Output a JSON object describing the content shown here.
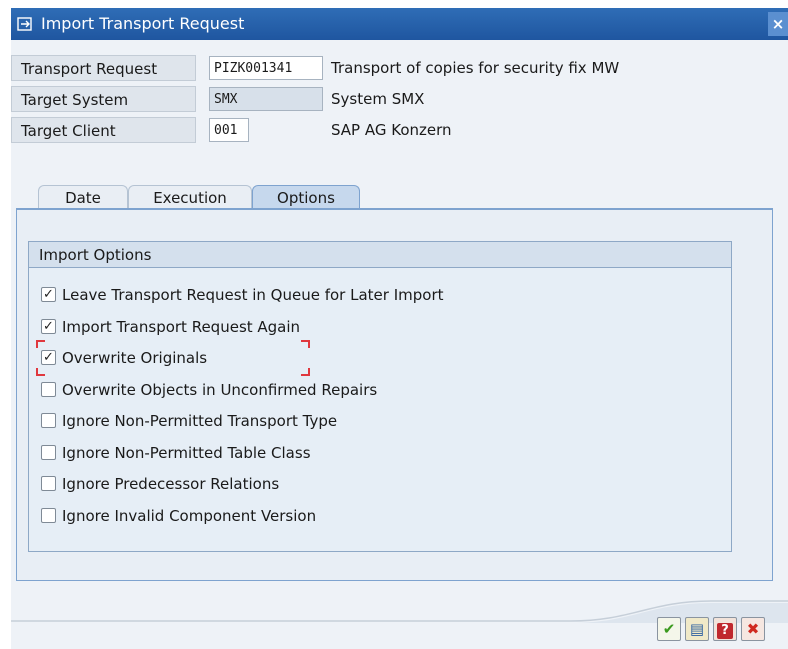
{
  "window": {
    "title": "Import Transport Request",
    "close_glyph": "×"
  },
  "header": {
    "transport_request": {
      "label": "Transport Request",
      "value": "PIZK001341",
      "description": "Transport of copies for security fix MW"
    },
    "target_system": {
      "label": "Target System",
      "value": "SMX",
      "description": "System SMX"
    },
    "target_client": {
      "label": "Target Client",
      "value": "001",
      "description": "SAP AG Konzern"
    }
  },
  "tabs": [
    {
      "label": "Date",
      "active": false
    },
    {
      "label": "Execution",
      "active": false
    },
    {
      "label": "Options",
      "active": true
    }
  ],
  "import_options": {
    "title": "Import Options",
    "items": [
      {
        "label": "Leave Transport Request in Queue for Later Import",
        "checked": true
      },
      {
        "label": "Import Transport Request Again",
        "checked": true
      },
      {
        "label": "Overwrite Originals",
        "checked": true
      },
      {
        "label": "Overwrite Objects in Unconfirmed Repairs",
        "checked": false
      },
      {
        "label": "Ignore Non-Permitted Transport Type",
        "checked": false
      },
      {
        "label": "Ignore Non-Permitted Table Class",
        "checked": false
      },
      {
        "label": "Ignore Predecessor Relations",
        "checked": false
      },
      {
        "label": "Ignore Invalid Component Version",
        "checked": false
      }
    ]
  },
  "footer_buttons": [
    {
      "name": "confirm",
      "icon": "checkmark-icon",
      "glyph": "✔",
      "color": "#3a9a1e"
    },
    {
      "name": "queue",
      "icon": "queue-icon",
      "glyph": "▤",
      "color": "#2a5ea0"
    },
    {
      "name": "help",
      "icon": "help-icon",
      "glyph": "?",
      "color": "#c0282d"
    },
    {
      "name": "cancel",
      "icon": "cancel-icon",
      "glyph": "✖",
      "color": "#d02a20"
    }
  ]
}
